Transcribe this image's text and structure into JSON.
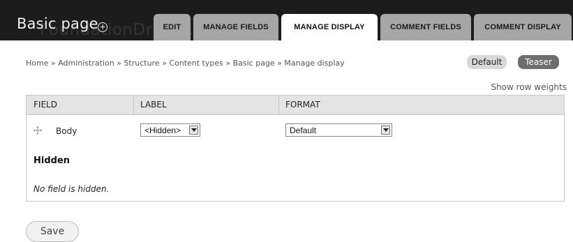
{
  "header": {
    "title": "Basic page",
    "add_icon": "circle-plus-icon",
    "watermark": "FoundationDrupal.com"
  },
  "tabs": [
    {
      "label": "EDIT",
      "active": false
    },
    {
      "label": "MANAGE FIELDS",
      "active": false
    },
    {
      "label": "MANAGE DISPLAY",
      "active": true
    },
    {
      "label": "COMMENT FIELDS",
      "active": false
    },
    {
      "label": "COMMENT DISPLAY",
      "active": false
    }
  ],
  "breadcrumb": "Home » Administration » Structure » Content types » Basic page » Manage display",
  "view_modes": {
    "default": "Default",
    "teaser": "Teaser"
  },
  "row_weights_link": "Show row weights",
  "table": {
    "columns": [
      "FIELD",
      "LABEL",
      "FORMAT"
    ],
    "rows": [
      {
        "field": "Body",
        "label": "<Hidden>",
        "format": "Default"
      }
    ],
    "hidden_heading": "Hidden",
    "hidden_empty_text": "No field is hidden."
  },
  "actions": {
    "save": "Save"
  },
  "colors": {
    "header_bg": "#1c1c1c",
    "tab_bg": "#a6a6a6",
    "active_tab_bg": "#ffffff",
    "teaser_pill_bg": "#6e6e6e",
    "table_header_bg": "#e4e4e4"
  }
}
